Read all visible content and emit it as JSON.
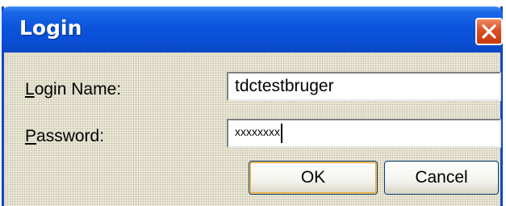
{
  "dialog": {
    "title": "Login",
    "close_icon": "close-icon",
    "colors": {
      "titlebar": "#0a4fd6",
      "close_button": "#de4e22",
      "body": "#ece9d8"
    }
  },
  "form": {
    "login_name": {
      "label_mnemonic": "L",
      "label_rest": "ogin Name:",
      "value": "tdctestbruger"
    },
    "password": {
      "label_mnemonic": "P",
      "label_rest": "assword:",
      "value": "xxxxxxxx"
    }
  },
  "buttons": {
    "ok_label": "OK",
    "cancel_label": "Cancel"
  }
}
